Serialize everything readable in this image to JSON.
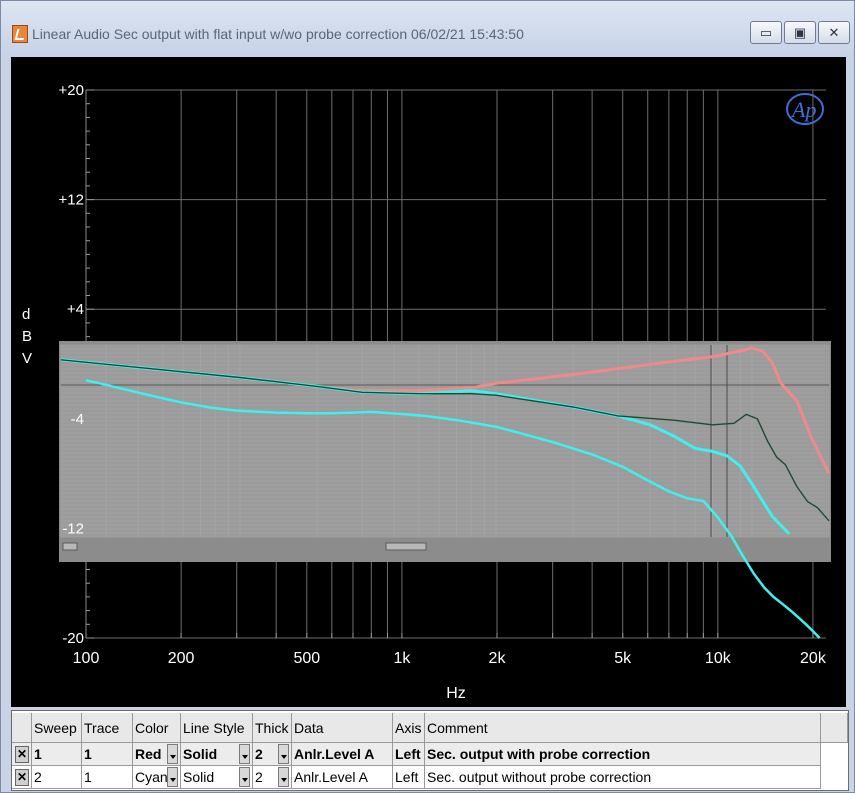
{
  "window": {
    "title": "Linear Audio  Sec output with flat input w/wo probe correction  06/02/21 15:43:50",
    "minimize_label": "▭",
    "maximize_label": "▣",
    "close_label": "✕"
  },
  "logo_text": "Ap",
  "chart_data": {
    "type": "line",
    "xscale": "log",
    "xlim": [
      100,
      22000
    ],
    "ylim": [
      -20,
      20
    ],
    "ylabel": "dBV",
    "xlabel": "Hz",
    "x_ticks": [
      {
        "value": 100,
        "label": "100"
      },
      {
        "value": 200,
        "label": "200"
      },
      {
        "value": 500,
        "label": "500"
      },
      {
        "value": 1000,
        "label": "1k"
      },
      {
        "value": 2000,
        "label": "2k"
      },
      {
        "value": 5000,
        "label": "5k"
      },
      {
        "value": 10000,
        "label": "10k"
      },
      {
        "value": 20000,
        "label": "20k"
      }
    ],
    "y_ticks": [
      {
        "value": 20,
        "label": "+20"
      },
      {
        "value": 12,
        "label": "+12"
      },
      {
        "value": 4,
        "label": "+4"
      },
      {
        "value": -4,
        "label": "-4"
      },
      {
        "value": -12,
        "label": "-12"
      },
      {
        "value": -20,
        "label": "-20"
      }
    ],
    "series": [
      {
        "name": "Sec. output without probe correction",
        "color": "#3ef0f0",
        "points": [
          [
            100,
            -1.2
          ],
          [
            110,
            -1.4
          ],
          [
            130,
            -1.8
          ],
          [
            160,
            -2.3
          ],
          [
            200,
            -2.8
          ],
          [
            250,
            -3.2
          ],
          [
            300,
            -3.4
          ],
          [
            400,
            -3.55
          ],
          [
            500,
            -3.6
          ],
          [
            600,
            -3.6
          ],
          [
            700,
            -3.55
          ],
          [
            800,
            -3.5
          ],
          [
            1000,
            -3.65
          ],
          [
            1200,
            -3.8
          ],
          [
            1500,
            -4.1
          ],
          [
            2000,
            -4.6
          ],
          [
            2500,
            -5.2
          ],
          [
            3000,
            -5.7
          ],
          [
            4000,
            -6.6
          ],
          [
            5000,
            -7.5
          ],
          [
            6000,
            -8.5
          ],
          [
            7000,
            -9.3
          ],
          [
            8000,
            -9.8
          ],
          [
            9000,
            -10.0
          ],
          [
            10000,
            -11.2
          ],
          [
            11000,
            -12.5
          ],
          [
            12000,
            -14.0
          ],
          [
            13000,
            -15.3
          ],
          [
            14000,
            -16.3
          ],
          [
            15000,
            -17.0
          ],
          [
            16000,
            -17.5
          ],
          [
            17000,
            -18.0
          ],
          [
            18000,
            -18.5
          ],
          [
            19000,
            -19.0
          ],
          [
            20000,
            -19.5
          ],
          [
            21000,
            -20.0
          ]
        ]
      }
    ],
    "inset": {
      "description_scale": "embedded overlay plot",
      "xlim": [
        20,
        20000
      ],
      "ylim": [
        -12,
        1
      ],
      "series": [
        {
          "name": "Sec. output with probe correction",
          "color": "#f08a8a",
          "points": [
            [
              20,
              0
            ],
            [
              100,
              -1.2
            ],
            [
              200,
              -1.8
            ],
            [
              300,
              -2.1
            ],
            [
              500,
              -2.1
            ],
            [
              800,
              -1.9
            ],
            [
              1000,
              -1.6
            ],
            [
              2000,
              -1.0
            ],
            [
              3000,
              -0.6
            ],
            [
              5000,
              -0.1
            ],
            [
              7000,
              0.2
            ],
            [
              9000,
              0.6
            ],
            [
              10000,
              0.8
            ],
            [
              11000,
              0.6
            ],
            [
              12000,
              -0.2
            ],
            [
              13000,
              -1.6
            ],
            [
              15000,
              -2.8
            ],
            [
              17000,
              -5.2
            ],
            [
              20000,
              -7.7
            ]
          ]
        },
        {
          "name": "Sec. output without probe correction",
          "color": "#3ef0f0",
          "points": [
            [
              20,
              0
            ],
            [
              100,
              -1.2
            ],
            [
              200,
              -1.8
            ],
            [
              300,
              -2.2
            ],
            [
              500,
              -2.3
            ],
            [
              800,
              -2.1
            ],
            [
              1000,
              -2.3
            ],
            [
              2000,
              -3.2
            ],
            [
              3000,
              -3.8
            ],
            [
              4000,
              -4.4
            ],
            [
              5000,
              -5.2
            ],
            [
              6000,
              -6.0
            ],
            [
              7000,
              -6.2
            ],
            [
              8000,
              -6.5
            ],
            [
              9000,
              -7.2
            ],
            [
              10000,
              -8.4
            ],
            [
              12000,
              -10.6
            ],
            [
              14000,
              -11.8
            ]
          ]
        },
        {
          "name": "",
          "color": "#1e4a32",
          "points": [
            [
              20,
              0
            ],
            [
              100,
              -1.2
            ],
            [
              200,
              -1.8
            ],
            [
              300,
              -2.2
            ],
            [
              500,
              -2.3
            ],
            [
              800,
              -2.3
            ],
            [
              1000,
              -2.4
            ],
            [
              2000,
              -3.2
            ],
            [
              3000,
              -3.8
            ],
            [
              5000,
              -4.1
            ],
            [
              7000,
              -4.4
            ],
            [
              8500,
              -4.3
            ],
            [
              9500,
              -3.7
            ],
            [
              10500,
              -4.0
            ],
            [
              11500,
              -5.5
            ],
            [
              12500,
              -6.6
            ],
            [
              13500,
              -7.1
            ],
            [
              15000,
              -8.6
            ],
            [
              16500,
              -9.6
            ],
            [
              18000,
              -10.0
            ],
            [
              20000,
              -10.9
            ]
          ]
        }
      ]
    }
  },
  "table": {
    "headers": [
      "Sweep",
      "Trace",
      "Color",
      "Line Style",
      "Thick",
      "Data",
      "Axis",
      "Comment"
    ],
    "rows": [
      {
        "check": "✕",
        "sweep": "1",
        "trace": "1",
        "color": "Red",
        "line_style": "Solid",
        "thick": "2",
        "data": "Anlr.Level A",
        "axis": "Left",
        "comment": "Sec. output with probe correction"
      },
      {
        "check": "✕",
        "sweep": "2",
        "trace": "1",
        "color": "Cyan",
        "line_style": "Solid",
        "thick": "2",
        "data": "Anlr.Level A",
        "axis": "Left",
        "comment": "Sec. output without probe correction"
      }
    ]
  }
}
